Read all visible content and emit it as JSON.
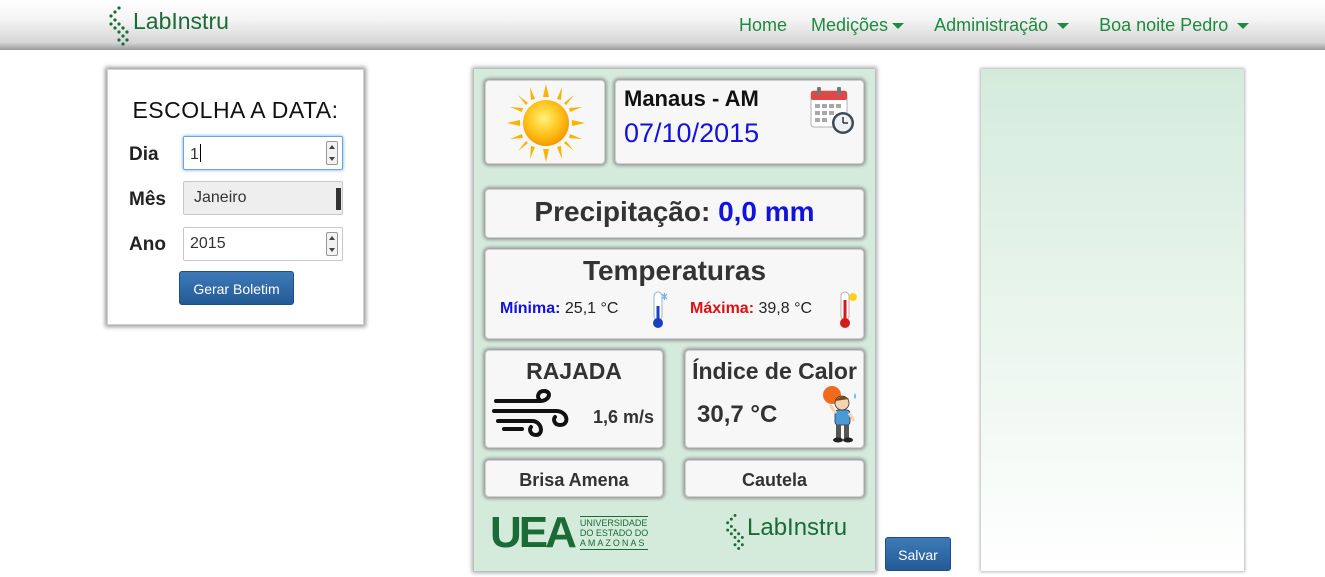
{
  "navbar": {
    "brand": "LabInstru",
    "links": [
      {
        "label": "Home",
        "dropdown": false
      },
      {
        "label": "Medições",
        "dropdown": true
      },
      {
        "label": "Administração",
        "dropdown": true
      },
      {
        "label": "Boa noite Pedro",
        "dropdown": true
      }
    ]
  },
  "date_form": {
    "title": "ESCOLHA A DATA:",
    "day_label": "Dia",
    "day_value": "1",
    "month_label": "Mês",
    "month_value": "Janeiro",
    "year_label": "Ano",
    "year_value": "2015",
    "submit_label": "Gerar Boletim"
  },
  "bulletin": {
    "city": "Manaus - AM",
    "date": "07/10/2015",
    "precipitation_label": "Precipitação:",
    "precipitation_value": "0,0 mm",
    "temperatures_title": "Temperaturas",
    "min_label": "Mínima:",
    "min_value": "25,1 °C",
    "max_label": "Máxima:",
    "max_value": "39,8 °C",
    "gust_title": "RAJADA",
    "gust_value": "1,6 m/s",
    "heat_title": "Índice de Calor",
    "heat_value": "30,7 °C",
    "gust_status": "Brisa Amena",
    "heat_status": "Cautela",
    "uea_abbr": "UEA",
    "uea_line1": "UNIVERSIDADE",
    "uea_line2": "DO ESTADO DO",
    "uea_line3": "AMAZONAS",
    "lab_logo": "LabInstru"
  },
  "save_label": "Salvar",
  "colors": {
    "brand_green": "#1a6b35",
    "nav_green": "#1e8a3f",
    "date_blue": "#1212dd",
    "max_red": "#e01010",
    "panel_bg": "#d4ebdc",
    "button_blue": "#2f6aa7"
  },
  "icons": {
    "weather": "sun-icon",
    "calendar": "calendar-clock-icon",
    "min_thermo": "cold-thermometer-icon",
    "max_thermo": "hot-thermometer-icon",
    "wind": "wind-icon",
    "heat": "heat-stressed-person-icon"
  }
}
